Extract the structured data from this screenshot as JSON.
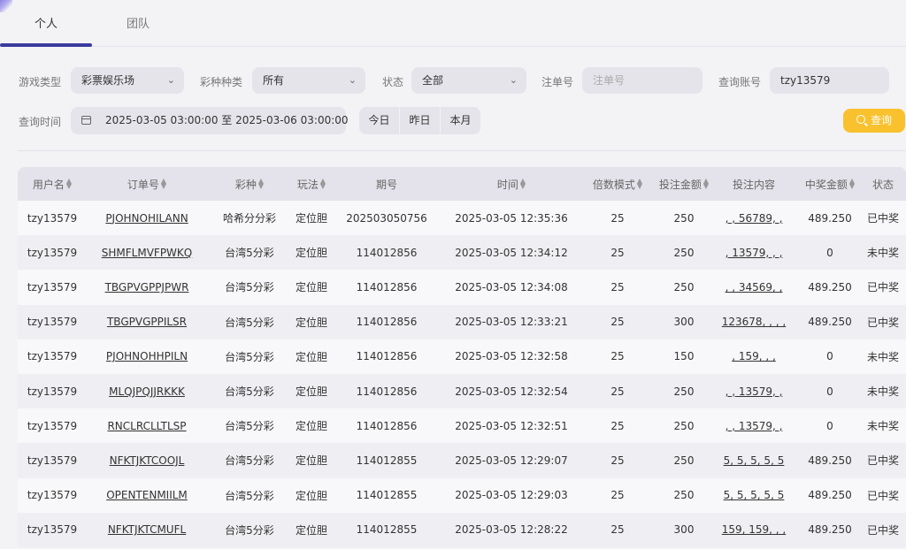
{
  "tabs": [
    "个人",
    "团队"
  ],
  "filters": {
    "game_type": {
      "label": "游戏类型",
      "value": "彩票娱乐场"
    },
    "lottery_type": {
      "label": "彩种种类",
      "value": "所有"
    },
    "status": {
      "label": "状态",
      "value": "全部"
    },
    "order_no": {
      "label": "注单号",
      "placeholder": "注单号"
    },
    "account": {
      "label": "查询账号",
      "value": "tzy13579"
    },
    "time": {
      "label": "查询时间",
      "value": "2025-03-05 03:00:00 至 2025-03-06 03:00:00"
    },
    "quick_ranges": [
      "今日",
      "昨日",
      "本月"
    ],
    "query_label": "查询"
  },
  "table": {
    "columns": [
      "用户名",
      "订单号",
      "彩种",
      "玩法",
      "期号",
      "时间",
      "倍数模式",
      "投注金额",
      "投注内容",
      "中奖金额",
      "状态"
    ],
    "rows": [
      [
        "tzy13579",
        "PJOHNOHILANN",
        "哈希分分彩",
        "定位胆",
        "202503050756",
        "2025-03-05 12:35:36",
        "25",
        "250",
        ", , 56789, ,",
        "489.250",
        "已中奖"
      ],
      [
        "tzy13579",
        "SHMFLMVFPWKQ",
        "台湾5分彩",
        "定位胆",
        "114012856",
        "2025-03-05 12:34:12",
        "25",
        "250",
        ", 13579, , ,",
        "0",
        "未中奖"
      ],
      [
        "tzy13579",
        "TBGPVGPPJPWR",
        "台湾5分彩",
        "定位胆",
        "114012856",
        "2025-03-05 12:34:08",
        "25",
        "250",
        ", , 34569, ,",
        "489.250",
        "已中奖"
      ],
      [
        "tzy13579",
        "TBGPVGPPILSR",
        "台湾5分彩",
        "定位胆",
        "114012856",
        "2025-03-05 12:33:21",
        "25",
        "300",
        "123678, , , ,",
        "489.250",
        "已中奖"
      ],
      [
        "tzy13579",
        "PJOHNOHHPILN",
        "台湾5分彩",
        "定位胆",
        "114012856",
        "2025-03-05 12:32:58",
        "25",
        "150",
        ", 159, , ,",
        "0",
        "未中奖"
      ],
      [
        "tzy13579",
        "MLQJPQJJRKKK",
        "台湾5分彩",
        "定位胆",
        "114012856",
        "2025-03-05 12:32:54",
        "25",
        "250",
        ", , 13579, ,",
        "0",
        "未中奖"
      ],
      [
        "tzy13579",
        "RNCLRCLLTLSP",
        "台湾5分彩",
        "定位胆",
        "114012856",
        "2025-03-05 12:32:51",
        "25",
        "250",
        ", , 13579, ,",
        "0",
        "未中奖"
      ],
      [
        "tzy13579",
        "NFKTJKTCOOJL",
        "台湾5分彩",
        "定位胆",
        "114012855",
        "2025-03-05 12:29:07",
        "25",
        "250",
        "5, 5, 5, 5, 5",
        "489.250",
        "已中奖"
      ],
      [
        "tzy13579",
        "OPENTENMIILM",
        "台湾5分彩",
        "定位胆",
        "114012855",
        "2025-03-05 12:29:03",
        "25",
        "250",
        "5, 5, 5, 5, 5",
        "489.250",
        "已中奖"
      ],
      [
        "tzy13579",
        "NFKTJKTCMUFL",
        "台湾5分彩",
        "定位胆",
        "114012855",
        "2025-03-05 12:28:22",
        "25",
        "300",
        "159, 159, , ,",
        "489.250",
        "已中奖"
      ]
    ]
  }
}
